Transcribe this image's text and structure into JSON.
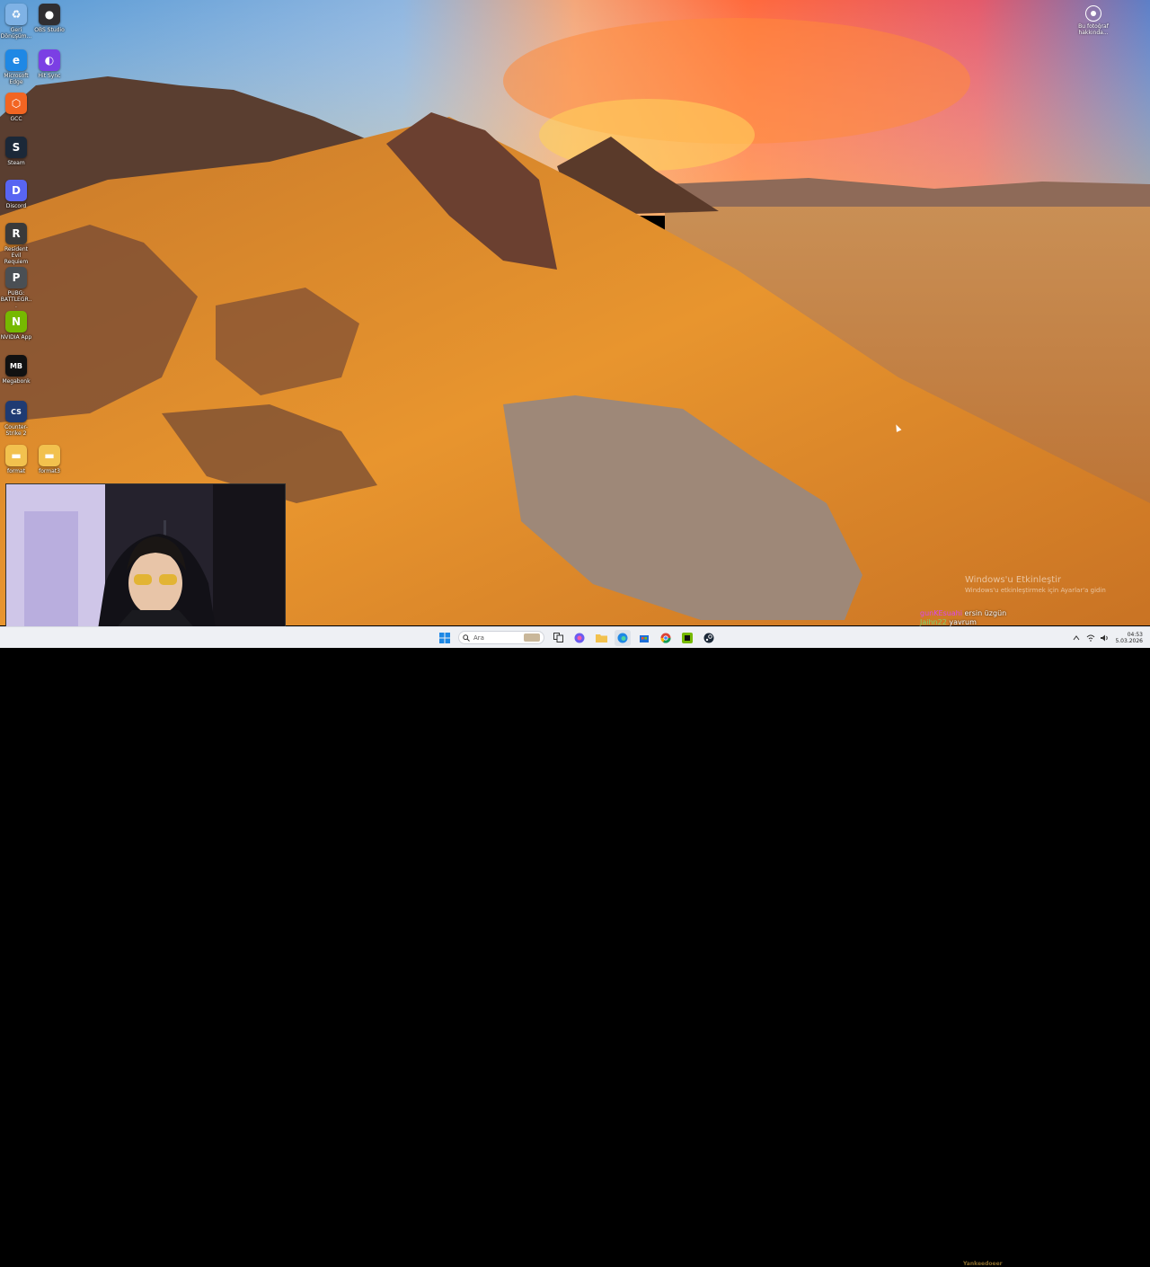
{
  "desktop": {
    "icons": [
      {
        "id": "recycle",
        "label": "Geri Dönüşüm...",
        "icon": "recycle-bin-icon",
        "color": "#7fb2e5",
        "glyph": "♻"
      },
      {
        "id": "obs",
        "label": "OBS Studio",
        "icon": "obs-icon",
        "color": "#302e31",
        "glyph": "●"
      },
      {
        "id": "edge",
        "label": "Microsoft Edge",
        "icon": "edge-icon",
        "color": "#1e88e5",
        "glyph": "e"
      },
      {
        "id": "hitsync",
        "label": "Hit Sync",
        "icon": "hit-sync-icon",
        "color": "#7b3fe4",
        "glyph": "◐"
      },
      {
        "id": "gcc",
        "label": "GCC",
        "icon": "gcc-icon",
        "color": "#f26522",
        "glyph": "⬡"
      },
      {
        "id": "steam",
        "label": "Steam",
        "icon": "steam-icon",
        "color": "#1b2838",
        "glyph": "S"
      },
      {
        "id": "discord",
        "label": "Discord",
        "icon": "discord-icon",
        "color": "#5865f2",
        "glyph": "D"
      },
      {
        "id": "resident",
        "label": "Resident Evil Requiem",
        "icon": "resident-evil-icon",
        "color": "#3a3a3a",
        "glyph": "R"
      },
      {
        "id": "pubg",
        "label": "PUBG: BATTLEGR...",
        "icon": "pubg-icon",
        "color": "#4a4f54",
        "glyph": "P"
      },
      {
        "id": "nvidia",
        "label": "NVIDIA App",
        "icon": "nvidia-icon",
        "color": "#76b900",
        "glyph": "N"
      },
      {
        "id": "megabonk",
        "label": "Megabonk",
        "icon": "megabonk-icon",
        "color": "#111111",
        "glyph": "MB"
      },
      {
        "id": "cs",
        "label": "Counter-Strike 2",
        "icon": "counter-strike-icon",
        "color": "#1f3b73",
        "glyph": "CS"
      },
      {
        "id": "format1",
        "label": "format",
        "icon": "folder-icon",
        "color": "#f2c14e",
        "glyph": "▬"
      },
      {
        "id": "format2",
        "label": "format3",
        "icon": "folder-icon",
        "color": "#f2c14e",
        "glyph": "▬"
      }
    ],
    "corner_label": "Bu fotoğraf hakkında..."
  },
  "watermark": {
    "title": "Windows'u Etkinleştir",
    "subtitle": "Windows'u etkinleştirmek için Ayarlar'a gidin"
  },
  "chat": [
    {
      "user": "gunKEsuahi",
      "message": "ersin üzgün"
    },
    {
      "user": "Jaihn22",
      "message": "yavrum"
    }
  ],
  "taskbar": {
    "search_placeholder": "Ara",
    "stream_text": "Yankeedoeer",
    "time": "04:53",
    "date": "5.03.2026",
    "apps": [
      "start-icon",
      "search-icon",
      "task-view-icon",
      "file-explorer-icon",
      "copilot-icon",
      "folder-icon",
      "edge-icon",
      "store-icon",
      "chrome-icon",
      "nvidia-icon",
      "steam-icon"
    ]
  }
}
